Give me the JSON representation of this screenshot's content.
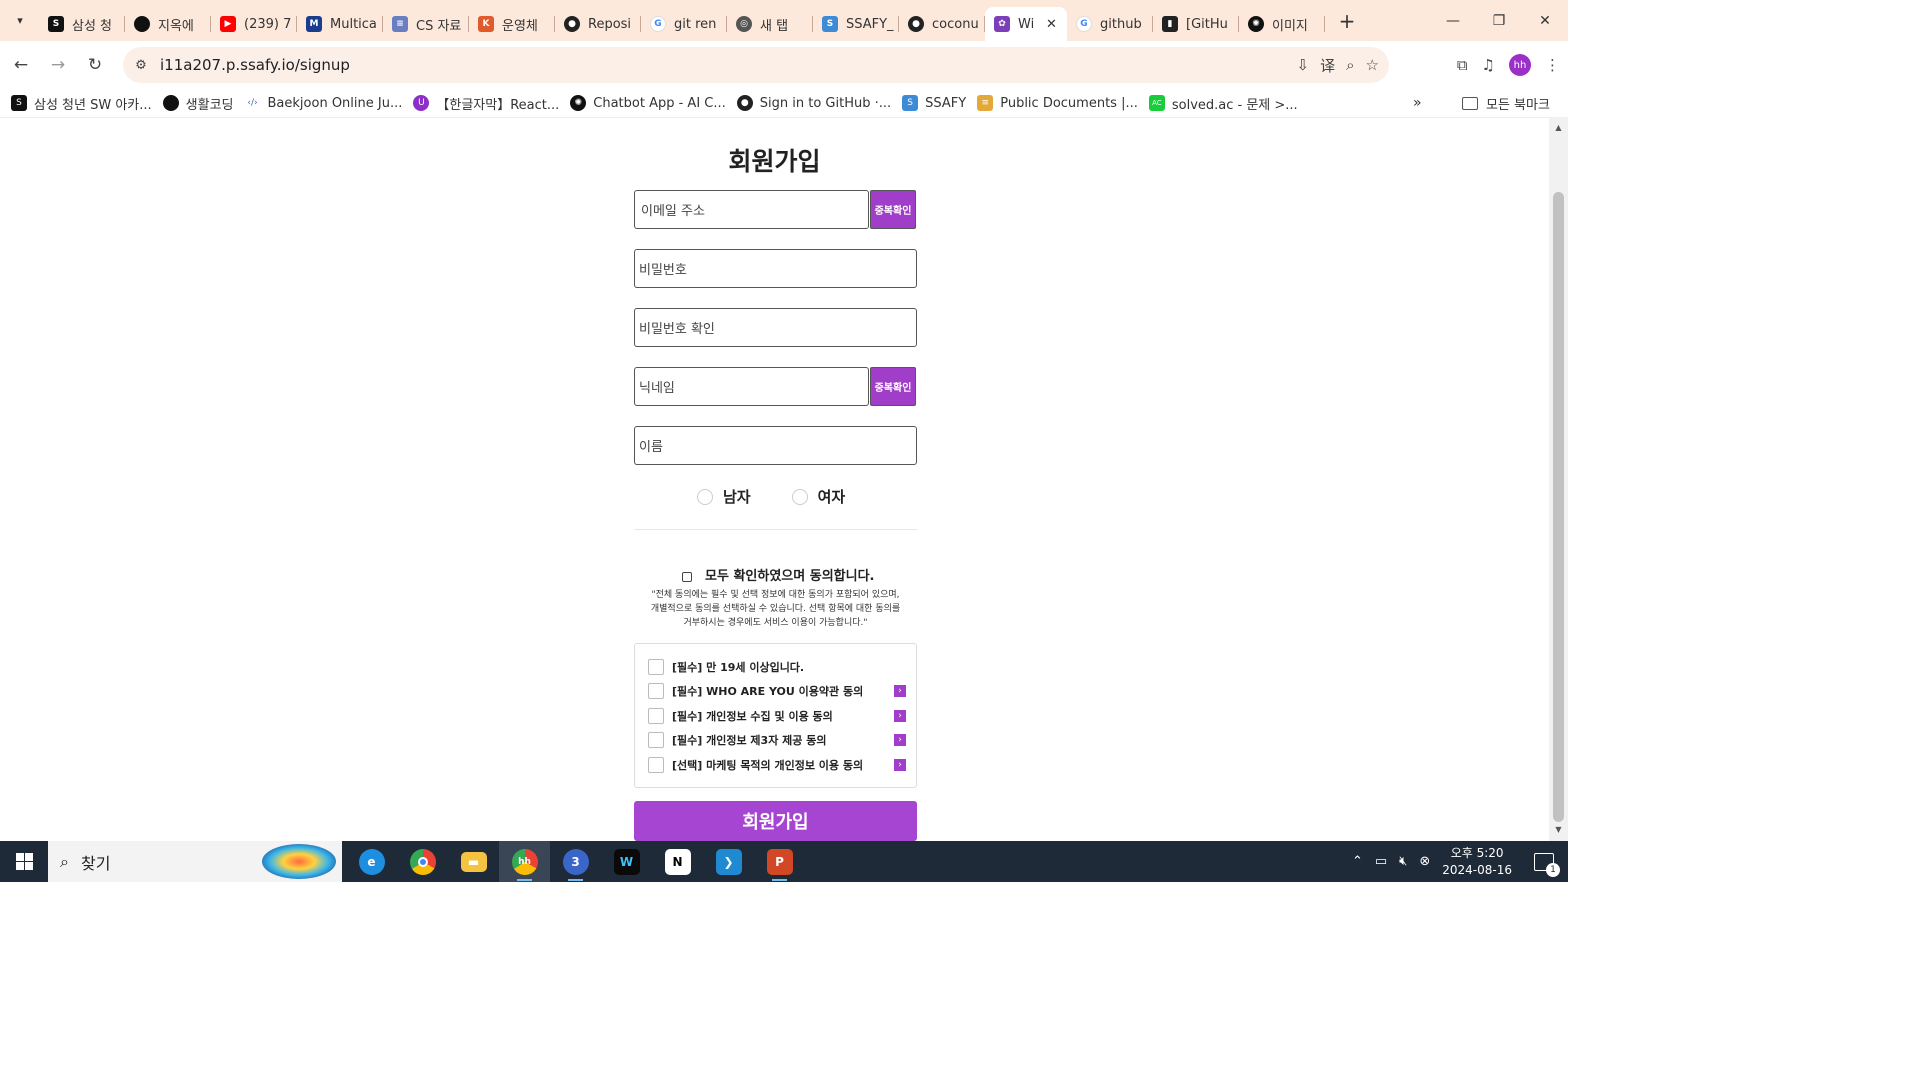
{
  "browser": {
    "tabs": [
      {
        "title": "삼성 청",
        "icon": "samsung-icon",
        "color": "#111111"
      },
      {
        "title": "지옥에",
        "icon": "circle-icon",
        "color": "#111111"
      },
      {
        "title": "(239) 7",
        "icon": "youtube-icon",
        "color": "#ff0000"
      },
      {
        "title": "Multica",
        "icon": "multicampus-icon",
        "color": "#1a3c8f"
      },
      {
        "title": "CS 자료",
        "icon": "stack-icon",
        "color": "#6a7ec2"
      },
      {
        "title": "운영체",
        "icon": "k-icon",
        "color": "#e05a2b"
      },
      {
        "title": "Reposi",
        "icon": "github-icon",
        "color": "#222222"
      },
      {
        "title": "git ren",
        "icon": "google-icon",
        "color": "#4285f4"
      },
      {
        "title": "새 탭",
        "icon": "chrome-icon",
        "color": "#555555"
      },
      {
        "title": "SSAFY_",
        "icon": "ssafy-icon",
        "color": "#3d8ad6"
      },
      {
        "title": "coconu",
        "icon": "github-icon",
        "color": "#222222"
      },
      {
        "title": "Wi",
        "icon": "app-icon",
        "color": "#7b3fb8",
        "active": true
      },
      {
        "title": "github",
        "icon": "google-icon",
        "color": "#4285f4"
      },
      {
        "title": "[GitHu",
        "icon": "bookmark-icon",
        "color": "#222222"
      },
      {
        "title": "이미지",
        "icon": "chatgpt-icon",
        "color": "#111111"
      }
    ],
    "url": "i11a207.p.ssafy.io/signup",
    "avatar": "hh",
    "bookmarks": [
      {
        "label": "삼성 청년 SW 아카...",
        "icon": "samsung-icon",
        "color": "#111111"
      },
      {
        "label": "생활코딩",
        "icon": "circle-icon",
        "color": "#111111"
      },
      {
        "label": "Baekjoon Online Ju...",
        "icon": "code-icon",
        "color": "#3d6bb3"
      },
      {
        "label": "【한글자막】React...",
        "icon": "udemy-icon",
        "color": "#8e2fc7"
      },
      {
        "label": "Chatbot App - AI C...",
        "icon": "chatgpt-icon",
        "color": "#111111"
      },
      {
        "label": "Sign in to GitHub ·...",
        "icon": "github-icon",
        "color": "#222222"
      },
      {
        "label": "SSAFY",
        "icon": "ssafy-icon",
        "color": "#3d8ad6"
      },
      {
        "label": "Public Documents |...",
        "icon": "docs-icon",
        "color": "#e2a93a"
      },
      {
        "label": "solved.ac - 문제 >...",
        "icon": "solvedac-icon",
        "color": "#17ce3a"
      }
    ],
    "all_bookmarks": "모든 북마크"
  },
  "signup": {
    "title": "회원가입",
    "email_placeholder": "이메일 주소",
    "dup_check": "중복확인",
    "password_placeholder": "비밀번호",
    "password_confirm_placeholder": "비밀번호 확인",
    "nickname_placeholder": "닉네임",
    "name_placeholder": "이름",
    "gender_male": "남자",
    "gender_female": "여자",
    "agree_all": "모두 확인하였으며 동의합니다.",
    "note_line1": "\"전체 동의에는 필수 및 선택 정보에 대한 동의가 포함되어 있으며,",
    "note_line2": "개별적으로 동의를 선택하실 수 있습니다. 선택 항목에 대한 동의를",
    "note_line3": "거부하시는 경우에도 서비스 이용이 가능합니다.\"",
    "terms": [
      {
        "label": "[필수] 만 19세 이상입니다.",
        "has_detail": false
      },
      {
        "label": "[필수] WHO ARE YOU 이용약관 동의",
        "has_detail": true
      },
      {
        "label": "[필수] 개인정보 수집 및 이용 동의",
        "has_detail": true
      },
      {
        "label": "[필수] 개인정보 제3자 제공 동의",
        "has_detail": true
      },
      {
        "label": "[선택] 마케팅 목적의 개인정보 이용 동의",
        "has_detail": true
      }
    ],
    "submit": "회원가입",
    "accent": "#a545d2"
  },
  "taskbar": {
    "search": "찾기",
    "time": "오후 5:20",
    "date": "2024-08-16",
    "notifications": "1",
    "apps": [
      "edge-icon",
      "chrome-icon",
      "file-explorer-icon",
      "chrome-profile-icon",
      "chrome-badge-icon",
      "webex-icon",
      "notion-icon",
      "vscode-icon",
      "powerpoint-icon"
    ]
  }
}
